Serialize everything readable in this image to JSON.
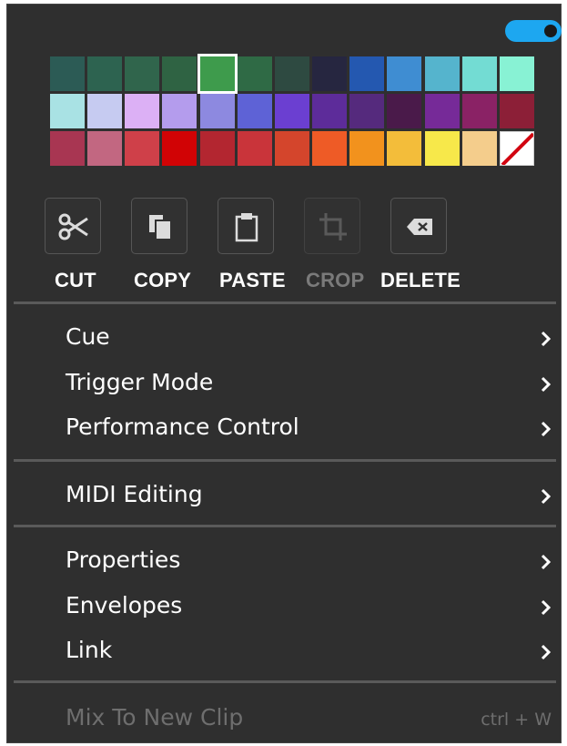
{
  "toggle": {
    "state": "on",
    "color": "#1da7f0"
  },
  "palette": {
    "selected_index": 4,
    "rows": [
      [
        "#2c5b55",
        "#2d6350",
        "#30654c",
        "#2f6343",
        "#3e9b4c",
        "#2f6a45",
        "#2e4a41",
        "#262640",
        "#2458b0",
        "#3f8dd2",
        "#55b4cd",
        "#73dcd3",
        "#88f2d4"
      ],
      [
        "#a9e2e4",
        "#c6cbf1",
        "#dcb0f5",
        "#b49ced",
        "#8d89e0",
        "#5e62d6",
        "#6b3fd1",
        "#5d2c9a",
        "#552a7d",
        "#4a1a4a",
        "#762a98",
        "#8a2265",
        "#8c1f37"
      ],
      [
        "#a83652",
        "#c26781",
        "#cf4049",
        "#d10305",
        "#b32630",
        "#c9343a",
        "#d4452c",
        "#ee5b26",
        "#f2921d",
        "#f3bd3a",
        "#f7e84a",
        "#f4cd8c",
        "none"
      ]
    ]
  },
  "tools": [
    {
      "id": "cut",
      "label": "CUT",
      "icon": "scissors-icon",
      "enabled": true
    },
    {
      "id": "copy",
      "label": "COPY",
      "icon": "copy-icon",
      "enabled": true
    },
    {
      "id": "paste",
      "label": "PASTE",
      "icon": "clipboard-icon",
      "enabled": true
    },
    {
      "id": "crop",
      "label": "CROP",
      "icon": "crop-icon",
      "enabled": false
    },
    {
      "id": "delete",
      "label": "DELETE",
      "icon": "backspace-icon",
      "enabled": true
    }
  ],
  "menu": {
    "cue": "Cue",
    "trigger_mode": "Trigger Mode",
    "performance_control": "Performance Control",
    "midi_editing": "MIDI Editing",
    "properties": "Properties",
    "envelopes": "Envelopes",
    "link": "Link",
    "mix_to_new_clip": "Mix To New Clip",
    "mix_shortcut": "ctrl + W"
  }
}
